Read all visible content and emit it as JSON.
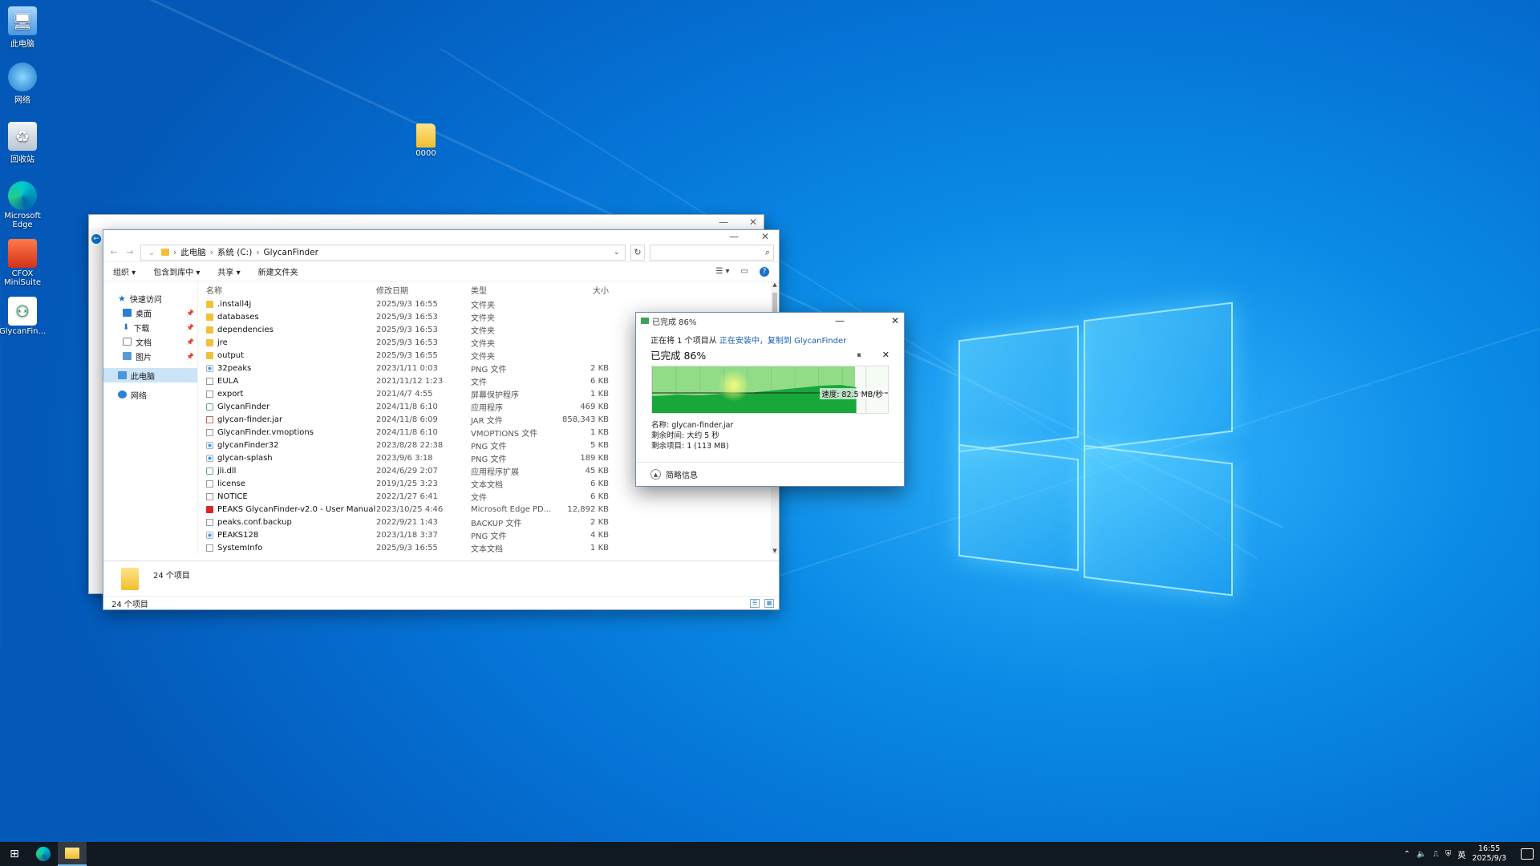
{
  "desktop": {
    "icons": [
      {
        "label": "此电脑",
        "icon": "computer-icon"
      },
      {
        "label": "网络",
        "icon": "network-icon"
      },
      {
        "label": "回收站",
        "icon": "recycle-bin-icon"
      },
      {
        "label": "Microsoft Edge",
        "icon": "edge-icon"
      },
      {
        "label": "CFOX MiniSuite",
        "icon": "app-icon"
      },
      {
        "label": "GlycanFin...",
        "icon": "glycanfinder-icon"
      }
    ],
    "folder": {
      "label": "0000",
      "icon": "folder-icon"
    }
  },
  "explorer": {
    "breadcrumb": [
      "此电脑",
      "系统 (C:)",
      "GlycanFinder"
    ],
    "commands": {
      "organize": "组织 ▾",
      "include": "包含到库中 ▾",
      "share": "共享 ▾",
      "new_folder": "新建文件夹"
    },
    "nav": {
      "quick_access": "快速访问",
      "desktop": "桌面",
      "downloads": "下载",
      "documents": "文档",
      "pictures": "图片",
      "this_pc": "此电脑",
      "network": "网络"
    },
    "columns": {
      "name": "名称",
      "date": "修改日期",
      "type": "类型",
      "size": "大小"
    },
    "files": [
      {
        "name": ".install4j",
        "date": "2025/9/3 16:55",
        "type": "文件夹",
        "size": "",
        "icon": "folder-icon"
      },
      {
        "name": "databases",
        "date": "2025/9/3 16:53",
        "type": "文件夹",
        "size": "",
        "icon": "folder-icon"
      },
      {
        "name": "dependencies",
        "date": "2025/9/3 16:53",
        "type": "文件夹",
        "size": "",
        "icon": "folder-icon"
      },
      {
        "name": "jre",
        "date": "2025/9/3 16:53",
        "type": "文件夹",
        "size": "",
        "icon": "folder-icon"
      },
      {
        "name": "output",
        "date": "2025/9/3 16:55",
        "type": "文件夹",
        "size": "",
        "icon": "folder-icon"
      },
      {
        "name": "32peaks",
        "date": "2023/1/11 0:03",
        "type": "PNG 文件",
        "size": "2 KB",
        "icon": "png-file-icon"
      },
      {
        "name": "EULA",
        "date": "2021/11/12 1:23",
        "type": "文件",
        "size": "6 KB",
        "icon": "file-icon"
      },
      {
        "name": "export",
        "date": "2021/4/7 4:55",
        "type": "屏幕保护程序",
        "size": "1 KB",
        "icon": "file-icon"
      },
      {
        "name": "GlycanFinder",
        "date": "2024/11/8 6:10",
        "type": "应用程序",
        "size": "469 KB",
        "icon": "app-file-icon"
      },
      {
        "name": "glycan-finder.jar",
        "date": "2024/11/8 6:09",
        "type": "JAR 文件",
        "size": "858,343 KB",
        "icon": "jar-file-icon"
      },
      {
        "name": "GlycanFinder.vmoptions",
        "date": "2024/11/8 6:10",
        "type": "VMOPTIONS 文件",
        "size": "1 KB",
        "icon": "file-icon"
      },
      {
        "name": "glycanFinder32",
        "date": "2023/8/28 22:38",
        "type": "PNG 文件",
        "size": "5 KB",
        "icon": "png-file-icon"
      },
      {
        "name": "glycan-splash",
        "date": "2023/9/6 3:18",
        "type": "PNG 文件",
        "size": "189 KB",
        "icon": "png-file-icon"
      },
      {
        "name": "jli.dll",
        "date": "2024/6/29 2:07",
        "type": "应用程序扩展",
        "size": "45 KB",
        "icon": "app-file-icon"
      },
      {
        "name": "license",
        "date": "2019/1/25 3:23",
        "type": "文本文档",
        "size": "6 KB",
        "icon": "file-icon"
      },
      {
        "name": "NOTICE",
        "date": "2022/1/27 6:41",
        "type": "文件",
        "size": "6 KB",
        "icon": "file-icon"
      },
      {
        "name": "PEAKS GlycanFinder-v2.0 - User Manual",
        "date": "2023/10/25 4:46",
        "type": "Microsoft Edge PD...",
        "size": "12,892 KB",
        "icon": "pdf-file-icon"
      },
      {
        "name": "peaks.conf.backup",
        "date": "2022/9/21 1:43",
        "type": "BACKUP 文件",
        "size": "2 KB",
        "icon": "file-icon"
      },
      {
        "name": "PEAKS128",
        "date": "2023/1/18 3:37",
        "type": "PNG 文件",
        "size": "4 KB",
        "icon": "png-file-icon"
      },
      {
        "name": "SystemInfo",
        "date": "2025/9/3 16:55",
        "type": "文本文档",
        "size": "1 KB",
        "icon": "file-icon"
      }
    ],
    "details_count": "24 个项目",
    "status_count": "24 个项目"
  },
  "copy_dialog": {
    "title": "已完成 86%",
    "line1_prefix": "正在将 1 个项目从 ",
    "line1_src": "正在安装中，复制到",
    "line1_dst": " GlycanFinder",
    "percent_text": "已完成 86%",
    "progress_fraction": 0.86,
    "speed": "速度: 82.5 MB/秒",
    "name": "名称: glycan-finder.jar",
    "time_left": "剩余时间: 大约 5 秒",
    "items_left": "剩余项目: 1 (113 MB)",
    "less_details": "简略信息",
    "pause_icon": "pause-icon",
    "stop_icon": "stop-icon"
  },
  "taskbar": {
    "tray_text": "英",
    "time": "16:55",
    "date": "2025/9/3"
  }
}
